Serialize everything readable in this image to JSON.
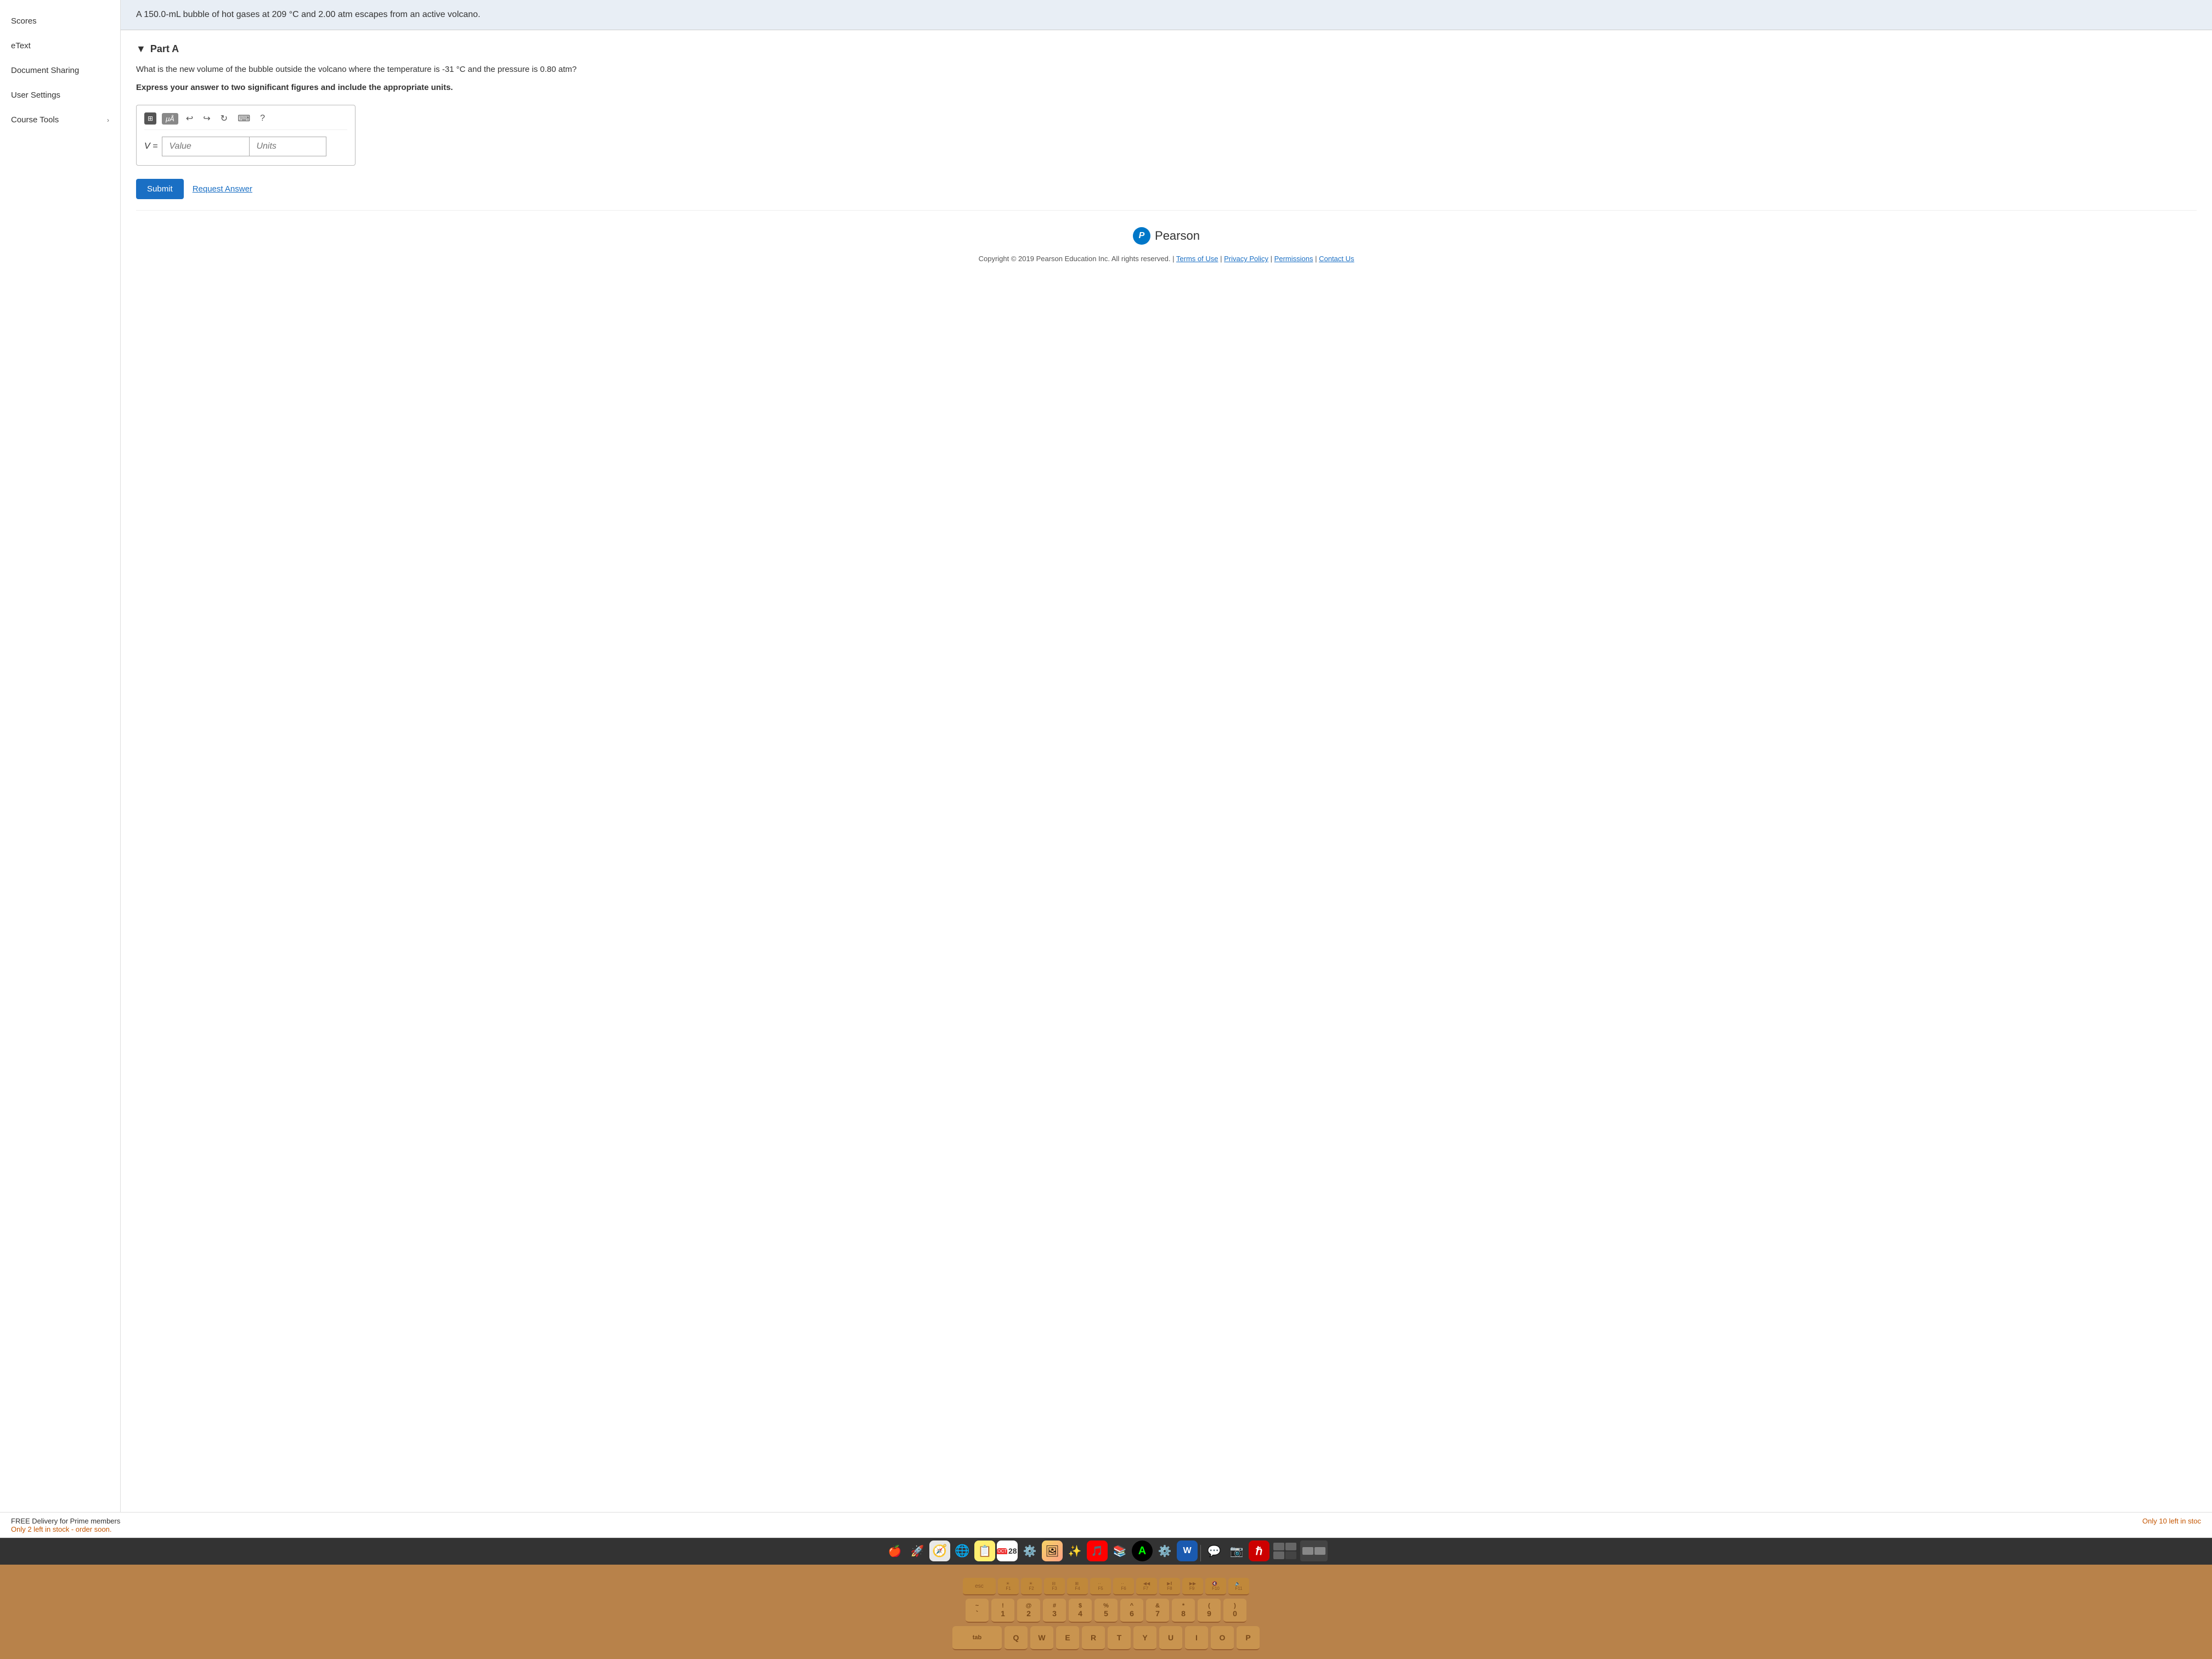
{
  "sidebar": {
    "items": [
      {
        "label": "Scores",
        "hasChevron": false
      },
      {
        "label": "eText",
        "hasChevron": false
      },
      {
        "label": "Document Sharing",
        "hasChevron": false
      },
      {
        "label": "User Settings",
        "hasChevron": false
      },
      {
        "label": "Course Tools",
        "hasChevron": true
      }
    ]
  },
  "question": {
    "context": "A 150.0-mL bubble of hot gases at 209 °C and 2.00 atm escapes from an active volcano.",
    "part_label": "Part A",
    "triangle": "▼",
    "text": "What is the new volume of the bubble outside the volcano where the temperature is -31 °C and the pressure is 0.80 atm?",
    "instruction": "Express your answer to two significant figures and include the appropriate units.",
    "value_label": "V =",
    "value_placeholder": "Value",
    "units_placeholder": "Units"
  },
  "toolbar": {
    "submit_label": "Submit",
    "request_answer_label": "Request Answer"
  },
  "footer": {
    "pearson_p": "P",
    "pearson_name": "Pearson",
    "copyright": "Copyright © 2019 Pearson Education Inc. All rights reserved.",
    "separator": "|",
    "links": [
      "Terms of Use",
      "Privacy Policy",
      "Permissions",
      "Contact Us"
    ]
  },
  "shopping": {
    "left_text": "FREE Delivery for Prime members",
    "left_sub": "Only 2 left in stock - order soon.",
    "right_sub": "Only 10 left in stoc"
  },
  "dock": {
    "items": [
      "🍎",
      "🚀",
      "🧭",
      "🌐",
      "📋",
      "📅",
      "⚙️",
      "📷",
      "✨",
      "🎵",
      "📚",
      "🅐",
      "⚙️",
      "📝",
      "💬",
      "📸",
      "ℝ",
      "🖥"
    ]
  },
  "keyboard": {
    "fn_row": [
      "esc",
      "F1",
      "F2",
      "F3",
      "F4",
      "F5",
      "F6",
      "F7",
      "F8",
      "F9",
      "F10",
      "F11"
    ],
    "row1": [
      {
        "top": "~",
        "main": "`"
      },
      {
        "top": "!",
        "main": "1"
      },
      {
        "top": "@",
        "main": "2"
      },
      {
        "top": "#",
        "main": "3"
      },
      {
        "top": "$",
        "main": "4"
      },
      {
        "top": "%",
        "main": "5"
      },
      {
        "top": "^",
        "main": "6"
      },
      {
        "top": "&",
        "main": "7"
      },
      {
        "top": "*",
        "main": "8"
      },
      {
        "top": "(",
        "main": "9"
      },
      {
        "top": ")",
        "main": "0"
      }
    ],
    "row2_labels": [
      "Q",
      "W",
      "E",
      "R",
      "T",
      "Y",
      "U",
      "I",
      "O",
      "P"
    ]
  }
}
